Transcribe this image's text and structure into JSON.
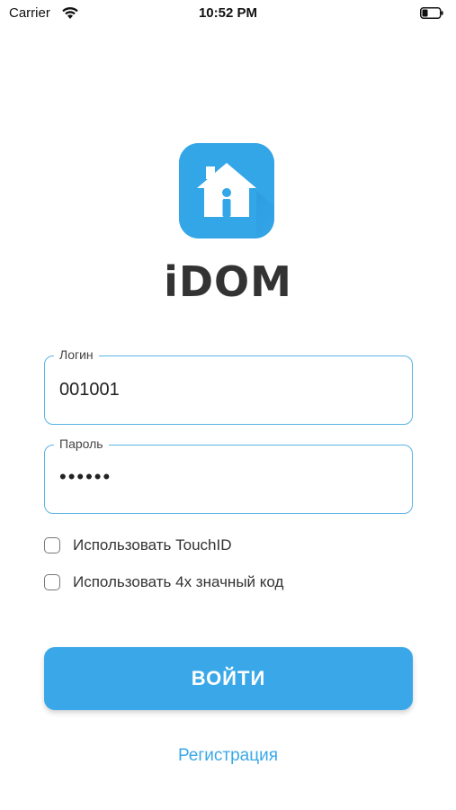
{
  "status_bar": {
    "carrier": "Carrier",
    "time": "10:52 PM",
    "icons": [
      "wifi-icon",
      "battery-icon"
    ]
  },
  "app": {
    "logo_icon": "house-icon",
    "brand_name": "iDOM",
    "accent_color": "#3aa8e8"
  },
  "form": {
    "login": {
      "label": "Логин",
      "value": "001001"
    },
    "password": {
      "label": "Пароль",
      "value": "••••••"
    },
    "options": [
      {
        "label": "Использовать TouchID",
        "checked": false
      },
      {
        "label": "Использовать 4х значный код",
        "checked": false
      }
    ],
    "submit_label": "ВОЙТИ",
    "register_label": "Регистрация"
  }
}
